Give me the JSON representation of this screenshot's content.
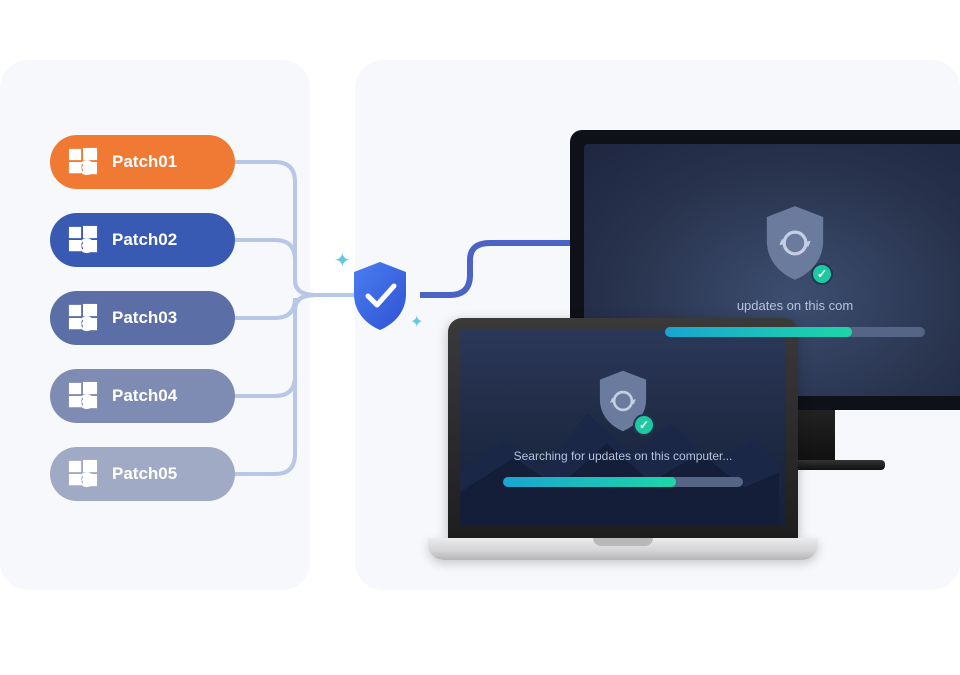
{
  "patches": [
    {
      "label": "Patch01",
      "color": "#f07a34"
    },
    {
      "label": "Patch02",
      "color": "#385ab3"
    },
    {
      "label": "Patch03",
      "color": "#5b6ea6"
    },
    {
      "label": "Patch04",
      "color": "#7e8cb4"
    },
    {
      "label": "Patch05",
      "color": "#a0aac4"
    }
  ],
  "shield": {
    "color": "#3c68e4",
    "checkColor": "#ffffff"
  },
  "laptop": {
    "statusText": "Searching for updates on this computer...",
    "progressPercent": 72,
    "checkBadgeColor": "#1dc9a0"
  },
  "monitor": {
    "statusText": "updates on this com",
    "progressPercent": 72,
    "checkBadgeColor": "#1dc9a0"
  },
  "colors": {
    "panelBg": "#f6f8fc",
    "connector": "#b8c7e8",
    "connectorMain": "#4b63c7"
  }
}
